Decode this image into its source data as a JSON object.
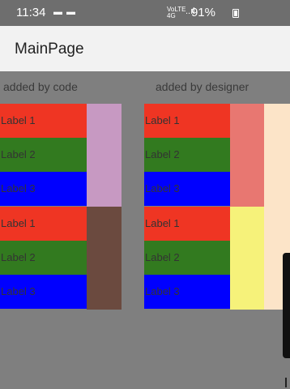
{
  "status_bar": {
    "time": "11:34",
    "notification_icons": "▬ ▬",
    "network_text": "VoLTE 4G",
    "signal": "..ıl",
    "battery_percent": "91%"
  },
  "app_bar": {
    "title": "MainPage"
  },
  "columns": {
    "left_caption": "added by code",
    "right_caption": "added by designer"
  },
  "labels": {
    "l1": "Label 1",
    "l2": "Label 2",
    "l3": "Label 3"
  },
  "colors": {
    "red": "#ef3523",
    "green": "#327a1f",
    "blue": "#0000ff",
    "plum": "#c799c2",
    "brown": "#6b4a3f",
    "salmon": "#e87771",
    "yellow": "#f6f27a",
    "bisque": "#fce4c8",
    "background": "#7f7f7f"
  }
}
